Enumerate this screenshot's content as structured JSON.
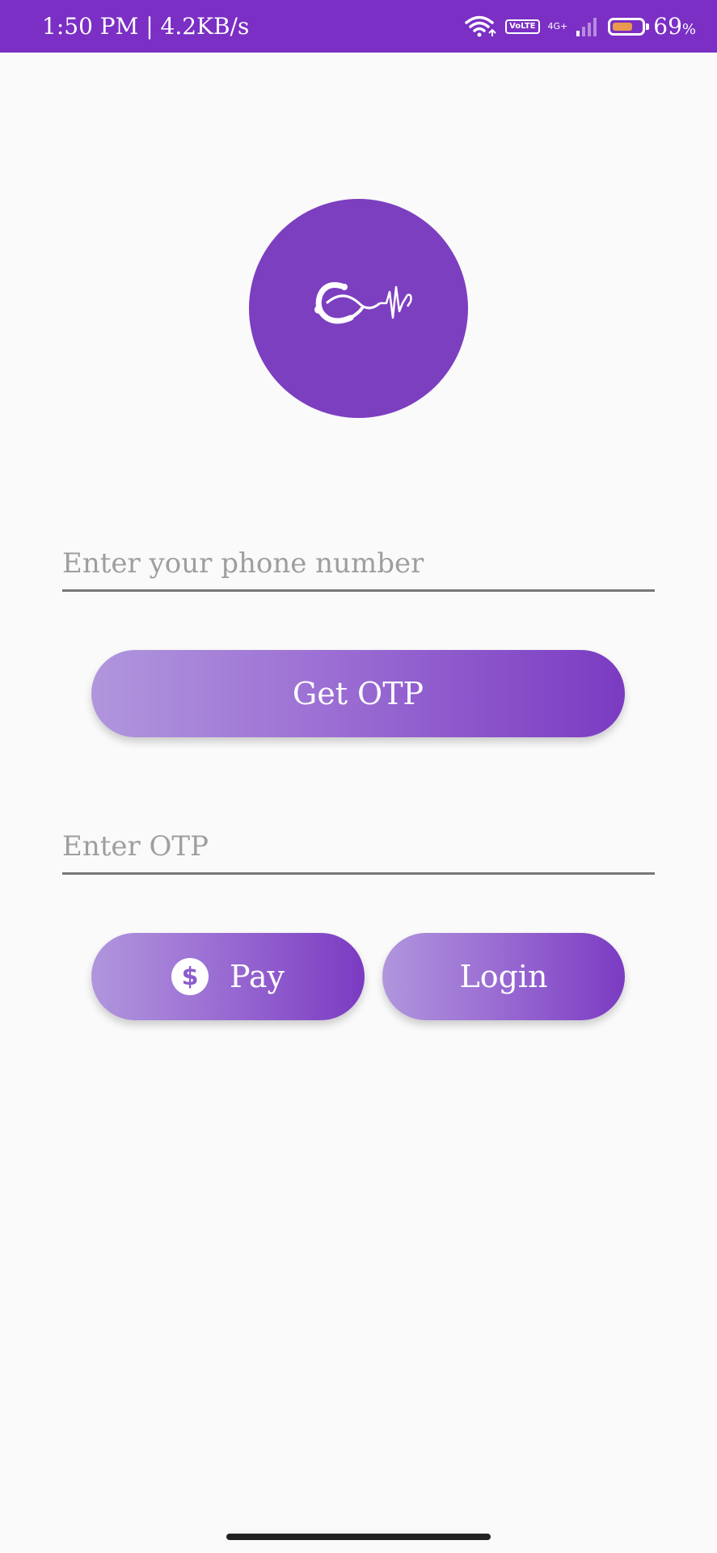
{
  "status_bar": {
    "time_speed": "1:50 PM | 4.2KB/s",
    "volte_line1": "Vo",
    "volte_line2": "LTE",
    "network_type": "4G+",
    "battery_percent": "69",
    "battery_unit": "%",
    "battery_level": 0.69,
    "background_color": "#7b2fc4"
  },
  "logo": {
    "icon": "stethoscope-heartbeat-icon",
    "background_color": "#7c3fc0"
  },
  "phone_field": {
    "placeholder": "Enter your phone number",
    "value": ""
  },
  "get_otp_button": {
    "label": "Get OTP"
  },
  "otp_field": {
    "placeholder": "Enter OTP",
    "value": ""
  },
  "pay_button": {
    "icon": "dollar-icon",
    "icon_glyph": "$",
    "label": "Pay"
  },
  "login_button": {
    "label": "Login"
  },
  "colors": {
    "accent": "#7b3bc2",
    "accent_light": "#b096dd"
  }
}
